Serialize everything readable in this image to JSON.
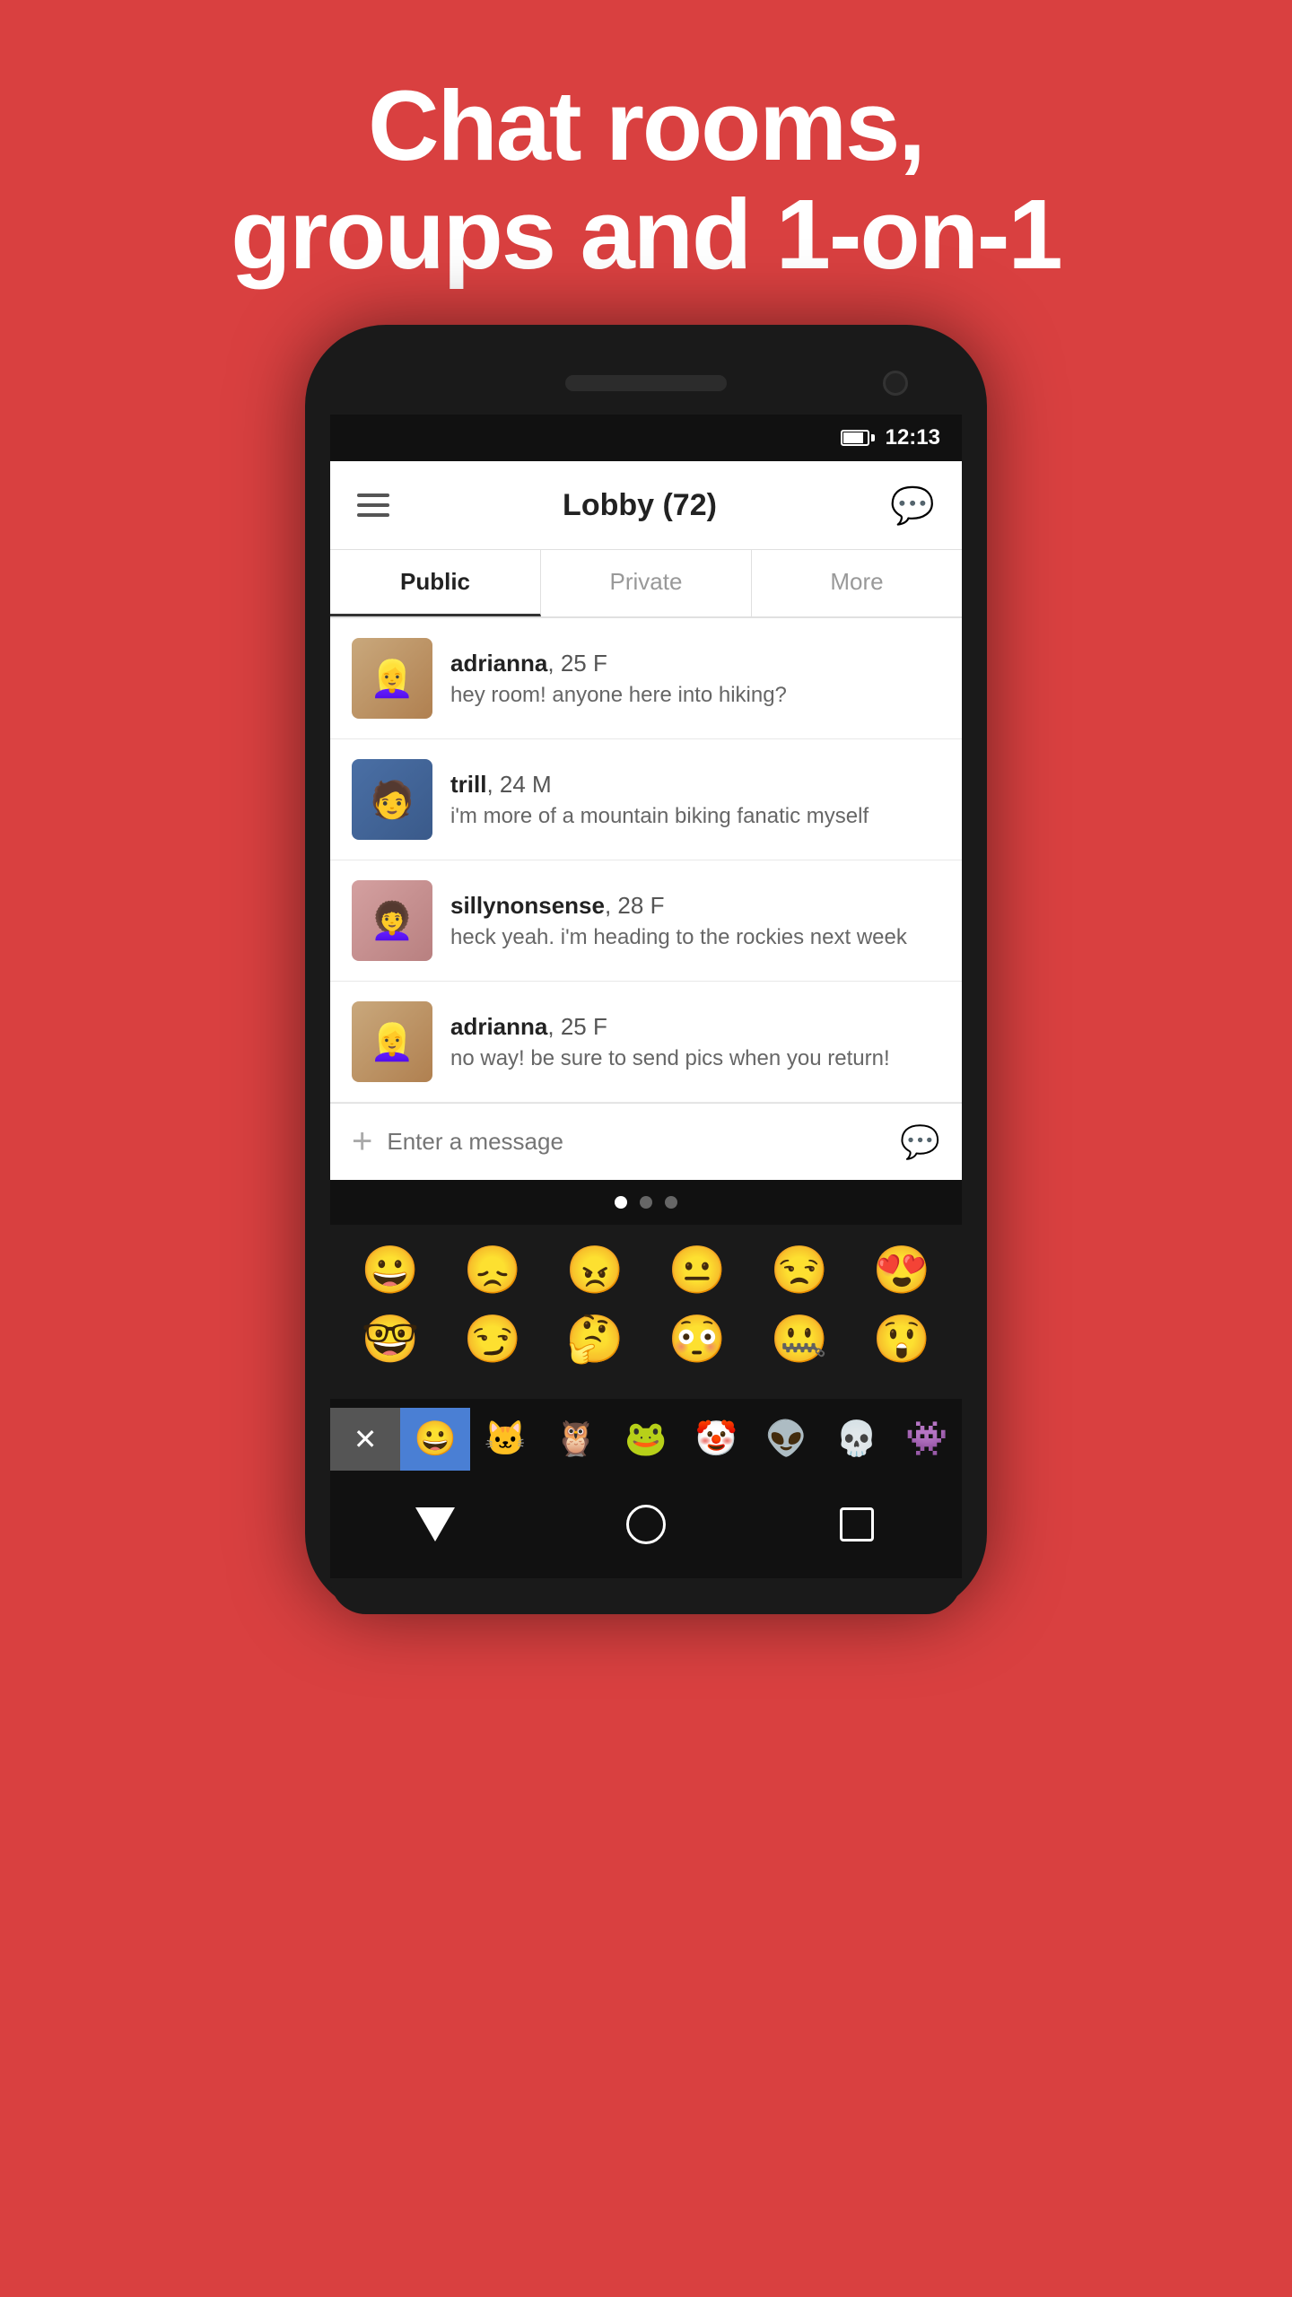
{
  "hero": {
    "title_line1": "Chat rooms,",
    "title_line2": "groups and 1-on-1"
  },
  "status_bar": {
    "time": "12:13"
  },
  "header": {
    "title": "Lobby (72)",
    "menu_label": "Menu",
    "chat_label": "New Chat"
  },
  "tabs": [
    {
      "id": "public",
      "label": "Public",
      "active": true
    },
    {
      "id": "private",
      "label": "Private",
      "active": false
    },
    {
      "id": "more",
      "label": "More",
      "active": false
    }
  ],
  "messages": [
    {
      "id": 1,
      "username": "adrianna",
      "age_gender": "25 F",
      "message": "hey room! anyone here into hiking?",
      "avatar_class": "avatar-adrianna",
      "avatar_emoji": "👱"
    },
    {
      "id": 2,
      "username": "trill",
      "age_gender": "24 M",
      "message": "i'm more of a mountain biking fanatic myself",
      "avatar_class": "avatar-trill",
      "avatar_emoji": "🧑"
    },
    {
      "id": 3,
      "username": "sillynonsense",
      "age_gender": "28 F",
      "message": "heck yeah. i'm heading to the rockies next week",
      "avatar_class": "avatar-silly",
      "avatar_emoji": "👩"
    },
    {
      "id": 4,
      "username": "adrianna",
      "age_gender": "25 F",
      "message": "no way! be sure to send pics when you return!",
      "avatar_class": "avatar-adrianna2",
      "avatar_emoji": "👱"
    }
  ],
  "input": {
    "placeholder": "Enter a message"
  },
  "emoji_rows": [
    [
      "😀",
      "😞",
      "😠",
      "😐",
      "😒",
      "😍"
    ],
    [
      "🤓",
      "😏",
      "🤔",
      "😳",
      "🤐",
      "😲"
    ]
  ],
  "emoji_categories": [
    "😀",
    "🐱",
    "🦉",
    "🐸",
    "🤡",
    "👽",
    "💀",
    "👾"
  ],
  "nav_buttons": [
    "back",
    "home",
    "recents"
  ]
}
